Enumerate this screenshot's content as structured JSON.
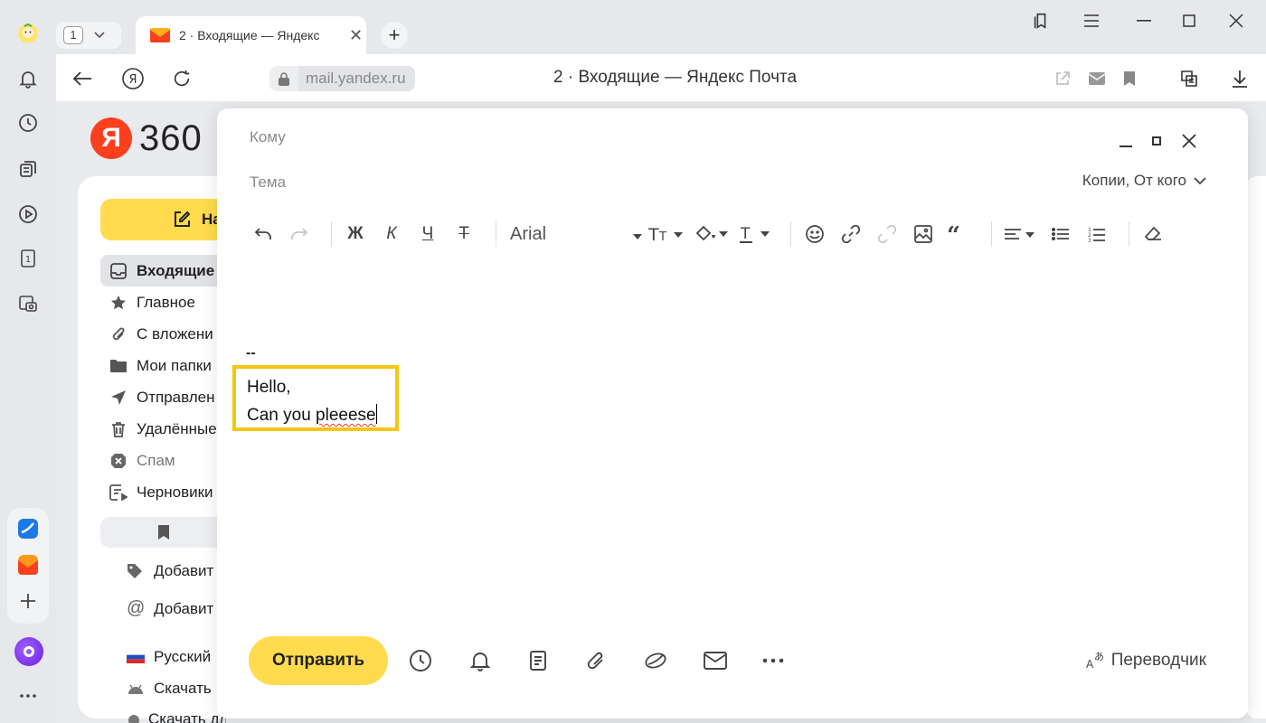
{
  "browser": {
    "tab_count": "1",
    "tab_title": "2 · Входящие — Яндекс",
    "url": "mail.yandex.ru",
    "page_title": "2 · Входящие — Яндекс Почта"
  },
  "mail": {
    "logo_ya": "Я",
    "logo_360": "360",
    "write_label": "На",
    "folders": [
      {
        "label": "Входящие",
        "icon": "inbox-icon"
      },
      {
        "label": "Главное",
        "icon": "star-icon"
      },
      {
        "label": "С вложени",
        "icon": "paperclip-icon"
      },
      {
        "label": "Мои папки",
        "icon": "folder-icon"
      },
      {
        "label": "Отправлен",
        "icon": "send-icon"
      },
      {
        "label": "Удалённые",
        "icon": "trash-icon"
      },
      {
        "label": "Спам",
        "icon": "spam-icon"
      },
      {
        "label": "Черновики",
        "icon": "drafts-icon"
      }
    ],
    "extras": [
      {
        "label": "Добавит",
        "icon": "tag-icon"
      },
      {
        "label": "Добавит",
        "icon": "at-icon"
      },
      {
        "label": "Русский",
        "icon": "flag-ru-icon"
      },
      {
        "label": "Скачать",
        "icon": "android-icon"
      },
      {
        "label": "Скачать для iOS",
        "icon": "apple-icon"
      }
    ]
  },
  "compose": {
    "to_label": "Кому",
    "subject_label": "Тема",
    "copies_label": "Копии, От кого",
    "font_name": "Arial",
    "toolbar": {
      "bold": "Ж",
      "italic": "К",
      "underline": "Ч",
      "strike": "Т"
    },
    "signature_dash": "--",
    "body_line1": "Hello,",
    "body_line2_plain": "Can you ",
    "body_line2_misspelled": "pleeese",
    "send_label": "Отправить",
    "translator_label": "Переводчик"
  }
}
